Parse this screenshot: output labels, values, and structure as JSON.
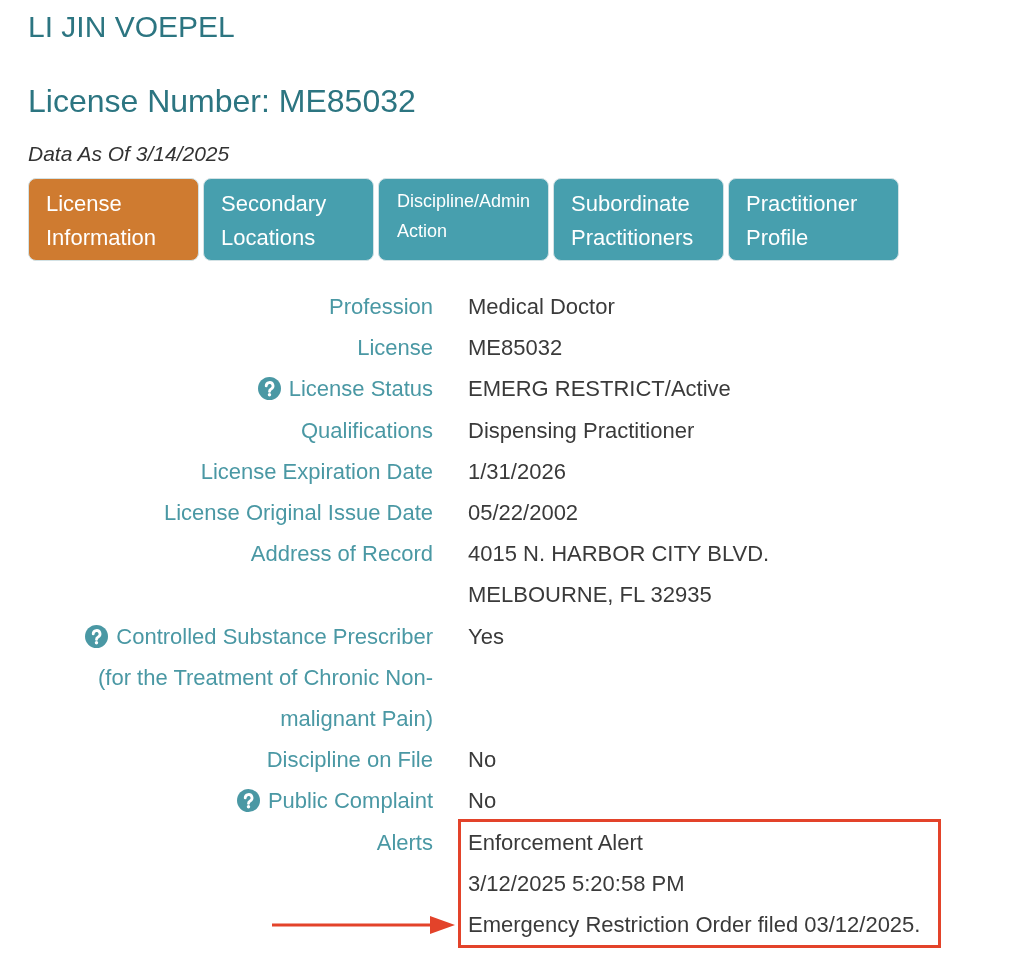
{
  "header": {
    "name": "LI JIN VOEPEL",
    "license_number": "License Number: ME85032",
    "data_as_of": "Data As Of 3/14/2025"
  },
  "tabs": [
    {
      "label": "License Information",
      "selected": true,
      "kind": "regular"
    },
    {
      "label": "Secondary Locations",
      "selected": false,
      "kind": "regular"
    },
    {
      "label": "Discipline/Admin Action",
      "selected": false,
      "kind": "compact"
    },
    {
      "label": "Subordinate Practitioners",
      "selected": false,
      "kind": "regular"
    },
    {
      "label": "Practitioner Profile",
      "selected": false,
      "kind": "regular"
    }
  ],
  "details": [
    {
      "label": "Profession",
      "help": false,
      "highlighted": false,
      "values": [
        "Medical Doctor"
      ]
    },
    {
      "label": "License",
      "help": false,
      "highlighted": false,
      "values": [
        "ME85032"
      ]
    },
    {
      "label": "License Status",
      "help": true,
      "highlighted": false,
      "values": [
        "EMERG RESTRICT/Active"
      ]
    },
    {
      "label": "Qualifications",
      "help": false,
      "highlighted": false,
      "values": [
        "Dispensing Practitioner"
      ]
    },
    {
      "label": "License Expiration Date",
      "help": false,
      "highlighted": false,
      "values": [
        "1/31/2026"
      ]
    },
    {
      "label": "License Original Issue Date",
      "help": false,
      "highlighted": false,
      "values": [
        "05/22/2002"
      ]
    },
    {
      "label": "Address of Record",
      "help": false,
      "highlighted": false,
      "values": [
        "4015 N. HARBOR CITY BLVD.",
        "MELBOURNE, FL 32935"
      ]
    },
    {
      "label": "Controlled Substance Prescriber (for the Treatment of Chronic Non-malignant Pain)",
      "help": true,
      "highlighted": false,
      "values": [
        "Yes"
      ]
    },
    {
      "label": "Discipline on File",
      "help": false,
      "highlighted": false,
      "values": [
        "No"
      ]
    },
    {
      "label": "Public Complaint",
      "help": true,
      "highlighted": false,
      "values": [
        "No"
      ]
    },
    {
      "label": "Alerts",
      "help": false,
      "highlighted": true,
      "values": [
        "Enforcement Alert",
        "3/12/2025 5:20:58 PM",
        "Emergency Restriction Order filed 03/12/2025."
      ]
    }
  ]
}
